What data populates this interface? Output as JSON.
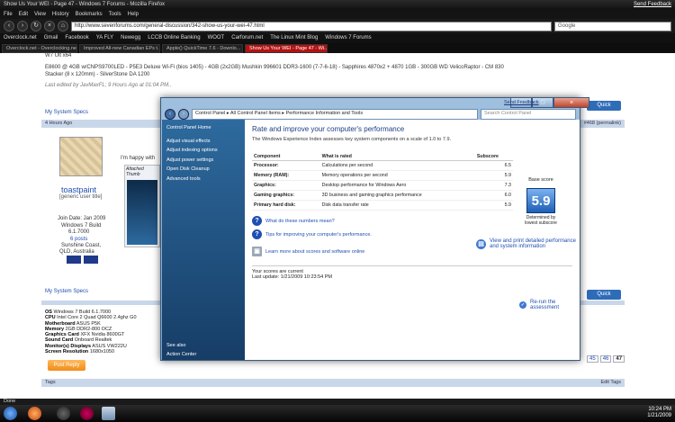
{
  "browser": {
    "title": "Show Us Your WEI - Page 47 - Windows 7 Forums - Mozilla Firefox",
    "send_feedback": "Send Feedback",
    "menu": [
      "File",
      "Edit",
      "View",
      "History",
      "Bookmarks",
      "Tools",
      "Help"
    ],
    "url": "http://www.sevenforums.com/general-discussion/342-show-us-your-wei-47.html",
    "search_engine": "Google",
    "bookmarks": [
      "Overclock.net",
      "Gmail",
      "Facebook",
      "YA FLY",
      "Newegg",
      "LCCB Online Banking",
      "WOOT",
      "Carforum.net",
      "The Linux Mint Blog",
      "Windows 7 Forums"
    ],
    "tabs": [
      {
        "label": "Overclock.net - Overclocking.net",
        "active": false
      },
      {
        "label": "Improved All-new Canadian EPs t...",
        "active": false
      },
      {
        "label": "Apple() QuickTime 7.6 - Downlo...",
        "active": false
      },
      {
        "label": "Show Us Your WEI - Page 47 - Wi...",
        "active": true
      }
    ],
    "status": "Done"
  },
  "forum": {
    "line1": "W7 Ult x64",
    "line2": "E8600 @ 4GB w/CNPS9700LED - P5E3 Deluxe Wi-Fi (bios 1405) - 4GB (2x2GB) Mushkin 996601 DDR3-1600 (7-7-6-18) - Sapphires 4870x2 + 4870 1GB - 300GB WD VelicoRaptor - CM 830",
    "line3": "Stacker (8 x 120mm) - SilverStone DA 1200",
    "edited": "Last edited by JavMaxFL; 9 Hours Ago at 01:04 PM..",
    "system_specs": "My System Specs",
    "quick": "Quick",
    "post_time": "4 Hours Ago",
    "post_link": "#468 (permalink)",
    "username": "toastpaint",
    "usertitle": "[generic user title]",
    "intro": "I'm happy with",
    "attached": "Attached Thumb",
    "join_date": "Join Date: Jan 2009",
    "os_info": [
      "Windows 7 Build",
      "6.1.7000"
    ],
    "posts": "6 posts",
    "location": [
      "Sunshine Coast,",
      "QLD, Australia"
    ],
    "specs": [
      {
        "k": "OS",
        "v": "Windows 7 Build 6.1.7000"
      },
      {
        "k": "CPU",
        "v": "Intel Core 2 Quad Q6600 2.4ghz G0"
      },
      {
        "k": "Motherboard",
        "v": "ASUS P5K"
      },
      {
        "k": "Memory",
        "v": "2GB DDR2-800 OCZ"
      },
      {
        "k": "Graphics Card",
        "v": "XFX Nvidia 8600GT"
      },
      {
        "k": "Sound Card",
        "v": "Onboard Realtek"
      },
      {
        "k": "Monitor(s) Displays",
        "v": "ASUS VW222U"
      },
      {
        "k": "Screen Resolution",
        "v": "1680x1050"
      }
    ],
    "post_reply": "Post Reply",
    "pages": [
      "45",
      "46",
      "47"
    ],
    "tags": "Tags",
    "edit_tags": "Edit Tags"
  },
  "control_panel": {
    "address": "Control Panel ▸ All Control Panel Items ▸ Performance Information and Tools",
    "search_placeholder": "Search Control Panel",
    "send_feedback": "Send Feedback",
    "sidebar": {
      "home": "Control Panel Home",
      "items": [
        "Adjust visual effects",
        "Adjust indexing options",
        "Adjust power settings",
        "Open Disk Cleanup",
        "Advanced tools"
      ],
      "see_also": "See also",
      "action_center": "Action Center"
    },
    "heading": "Rate and improve your computer's performance",
    "subheading": "The Windows Experience Index assesses key system components on a scale of 1.0 to 7.9.",
    "columns": [
      "Component",
      "What is rated",
      "Subscore",
      "Base score"
    ],
    "rows": [
      {
        "component": "Processor:",
        "rated": "Calculations per second",
        "subscore": "6.5"
      },
      {
        "component": "Memory (RAM):",
        "rated": "Memory operations per second",
        "subscore": "5.9"
      },
      {
        "component": "Graphics:",
        "rated": "Desktop performance for Windows Aero",
        "subscore": "7.3"
      },
      {
        "component": "Gaming graphics:",
        "rated": "3D business and gaming graphics performance",
        "subscore": "6.0"
      },
      {
        "component": "Primary hard disk:",
        "rated": "Disk data transfer rate",
        "subscore": "5.9"
      }
    ],
    "base_score": "5.9",
    "base_caption": "Determined by lowest subscore",
    "links": {
      "what_mean": "What do these numbers mean?",
      "tips": "Tips for improving your computer's performance.",
      "learn_more": "Learn more about scores and software online",
      "view_print": "View and print detailed performance and system information"
    },
    "current": "Your scores are current",
    "last_update": "Last update: 1/21/2009 10:23:54 PM",
    "rerun": "Re-run the assessment"
  },
  "clock": {
    "time": "10:24 PM",
    "date": "1/21/2009"
  }
}
